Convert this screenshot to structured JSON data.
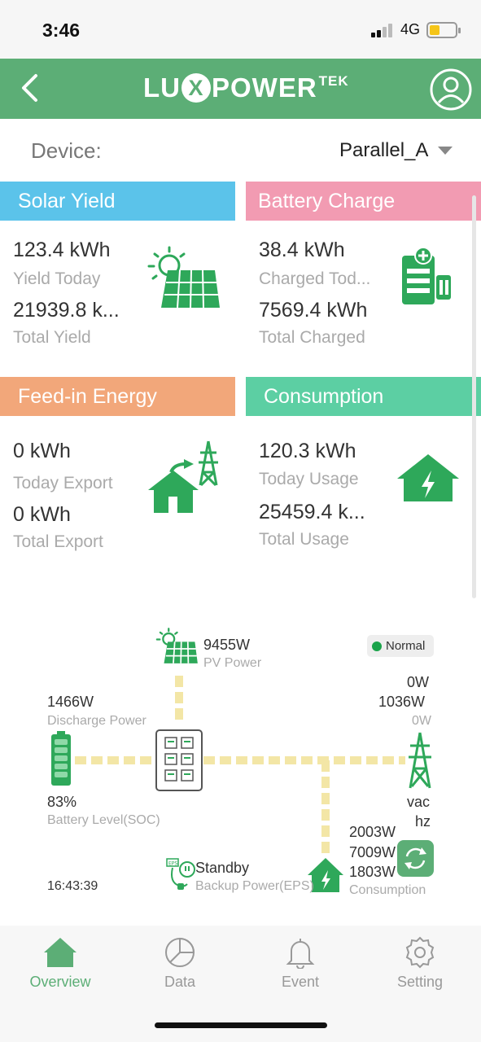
{
  "status_bar": {
    "time": "3:46",
    "network": "4G"
  },
  "header": {
    "logo_left": "LU",
    "logo_x": "X",
    "logo_right": "POWER",
    "logo_sup": "TEK"
  },
  "device": {
    "label": "Device:",
    "selected": "Parallel_A"
  },
  "cards": {
    "solar": {
      "title": "Solar Yield",
      "today_value": "123.4 kWh",
      "today_label": "Yield Today",
      "total_value": "21939.8 k...",
      "total_label": "Total Yield",
      "color": "#5bc3ea"
    },
    "battery": {
      "title": "Battery Charge",
      "today_value": "38.4 kWh",
      "today_label": "Charged Tod...",
      "total_value": "7569.4 kWh",
      "total_label": "Total Charged",
      "color": "#f29bb2"
    },
    "feedin": {
      "title": "Feed-in Energy",
      "today_value": "0 kWh",
      "today_label": "Today Export",
      "total_value": "0 kWh",
      "total_label": "Total Export",
      "color": "#f2a77a"
    },
    "consumption": {
      "title": "Consumption",
      "today_value": "120.3 kWh",
      "today_label": "Today Usage",
      "total_value": "25459.4 k...",
      "total_label": "Total Usage",
      "color": "#5ccfa3"
    }
  },
  "flow": {
    "pv_power": "9455W",
    "pv_label": "PV Power",
    "status": "Normal",
    "grid_values": [
      "0W",
      "1036W"
    ],
    "grid_sub": "0W",
    "discharge_power": "1466W",
    "discharge_label": "Discharge Power",
    "soc": "83%",
    "soc_label": "Battery Level(SOC)",
    "grid_vac": "vac",
    "grid_hz": "hz",
    "consumption_values": [
      "2003W",
      "7009W",
      "1803W"
    ],
    "consumption_label": "Consumption",
    "eps_status": "Standby",
    "eps_label": "Backup Power(EPS)",
    "timestamp": "16:43:39"
  },
  "nav": [
    {
      "label": "Overview",
      "icon": "home-icon",
      "active": true
    },
    {
      "label": "Data",
      "icon": "pie-chart-icon",
      "active": false
    },
    {
      "label": "Event",
      "icon": "bell-icon",
      "active": false
    },
    {
      "label": "Setting",
      "icon": "gear-icon",
      "active": false
    }
  ],
  "colors": {
    "brand_green": "#5cae76",
    "icon_green": "#2ea85a",
    "flow_arrow": "#f3e6a6"
  }
}
